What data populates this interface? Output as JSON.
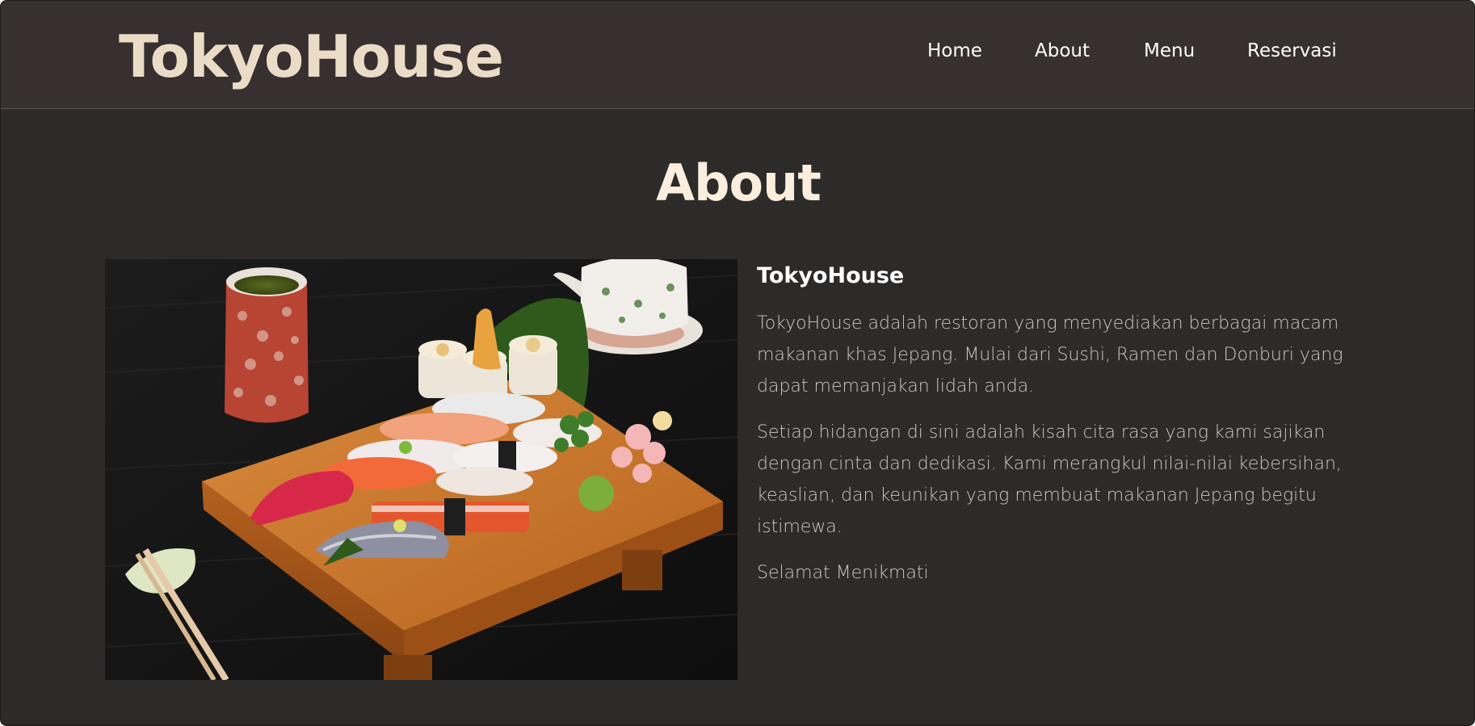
{
  "navbar": {
    "brand": "TokyoHouse",
    "links": [
      "Home",
      "About",
      "Menu",
      "Reservasi"
    ]
  },
  "about": {
    "heading": "About",
    "subtitle": "TokyoHouse",
    "paragraphs": [
      "TokyoHouse adalah restoran yang menyediakan berbagai macam makanan khas Jepang. Mulai dari Sushi, Ramen dan Donburi yang dapat memanjakan lidah anda.",
      "Setiap hidangan di sini adalah kisah cita rasa yang kami sajikan dengan cinta dan dedikasi. Kami merangkul nilai-nilai kebersihan, keaslian, dan keunikan yang membuat makanan Jepang begitu istimewa.",
      "Selamat Menikmati"
    ]
  },
  "colors": {
    "navbar_bg": "#382f30",
    "page_bg": "#2d2b2a",
    "brand": "#eadcc6",
    "heading": "#fbeede",
    "body_text": "#cdc4bd"
  }
}
